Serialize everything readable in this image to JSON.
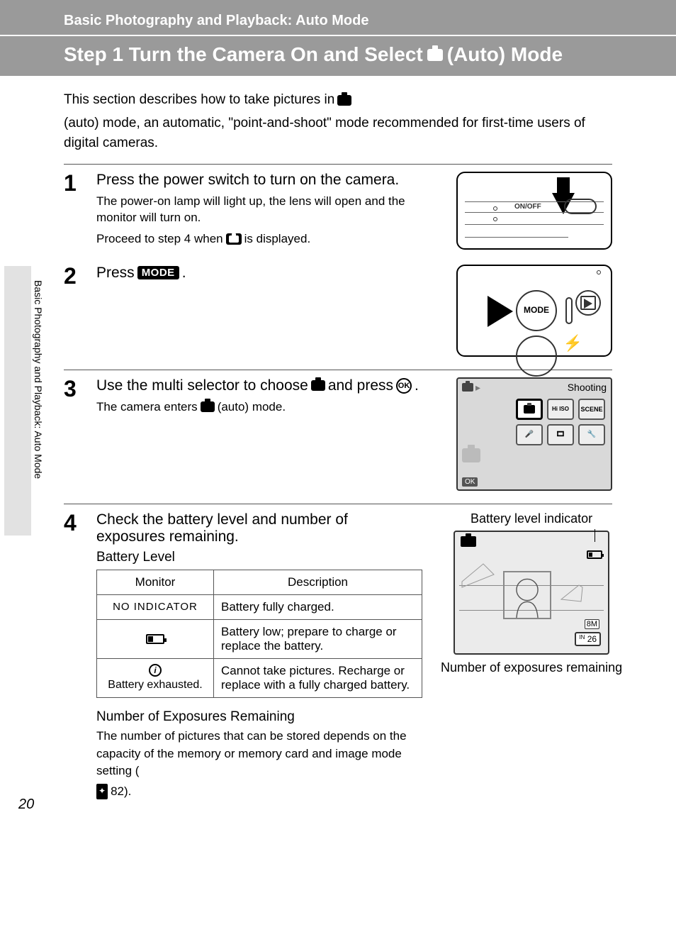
{
  "header": {
    "section": "Basic Photography and Playback: Auto Mode",
    "title_pre": "Step 1 Turn the Camera On and Select",
    "title_post": "(Auto) Mode"
  },
  "intro": {
    "pre": "This section describes how to take pictures in",
    "post": "(auto) mode, an automatic, \"point-and-shoot\" mode recommended for first-time users of digital cameras."
  },
  "sidebar": {
    "label": "Basic Photography and Playback: Auto Mode"
  },
  "steps": {
    "s1": {
      "num": "1",
      "title": "Press the power switch to turn on the camera.",
      "sub1": "The power-on lamp will light up, the lens will open and the monitor will turn on.",
      "sub2_pre": "Proceed to step 4 when",
      "sub2_post": "is displayed.",
      "onoff": "ON/OFF"
    },
    "s2": {
      "num": "2",
      "title_pre": "Press",
      "title_post": ".",
      "mode_label": "MODE"
    },
    "s3": {
      "num": "3",
      "title_pre": "Use the multi selector to choose",
      "title_mid": "and press",
      "title_post": ".",
      "sub_pre": "The camera enters",
      "sub_post": "(auto) mode.",
      "ok": "OK",
      "screen": {
        "title": "Shooting",
        "ok": "OK",
        "hi_iso": "Hi ISO",
        "scene": "SCENE"
      }
    },
    "s4": {
      "num": "4",
      "title": "Check the battery level and number of exposures remaining.",
      "battery_level_heading": "Battery Level",
      "table": {
        "h_monitor": "Monitor",
        "h_desc": "Description",
        "r1_monitor": "NO INDICATOR",
        "r1_desc": "Battery fully charged.",
        "r2_desc": "Battery low; prepare to charge or replace the battery.",
        "r3_label": "Battery exhausted.",
        "r3_desc": "Cannot take pictures. Recharge or replace with a fully charged battery."
      },
      "exposures_heading": "Number of Exposures Remaining",
      "exposures_text_pre": "The number of pictures that can be stored depends on the capacity of the memory or memory card and image mode setting (",
      "exposures_text_post": " 82).",
      "right": {
        "battery_caption": "Battery level indicator",
        "exposures_caption": "Number of exposures remaining",
        "count": "26",
        "rm": "8M",
        "in": "IN"
      }
    }
  },
  "page_number": "20"
}
